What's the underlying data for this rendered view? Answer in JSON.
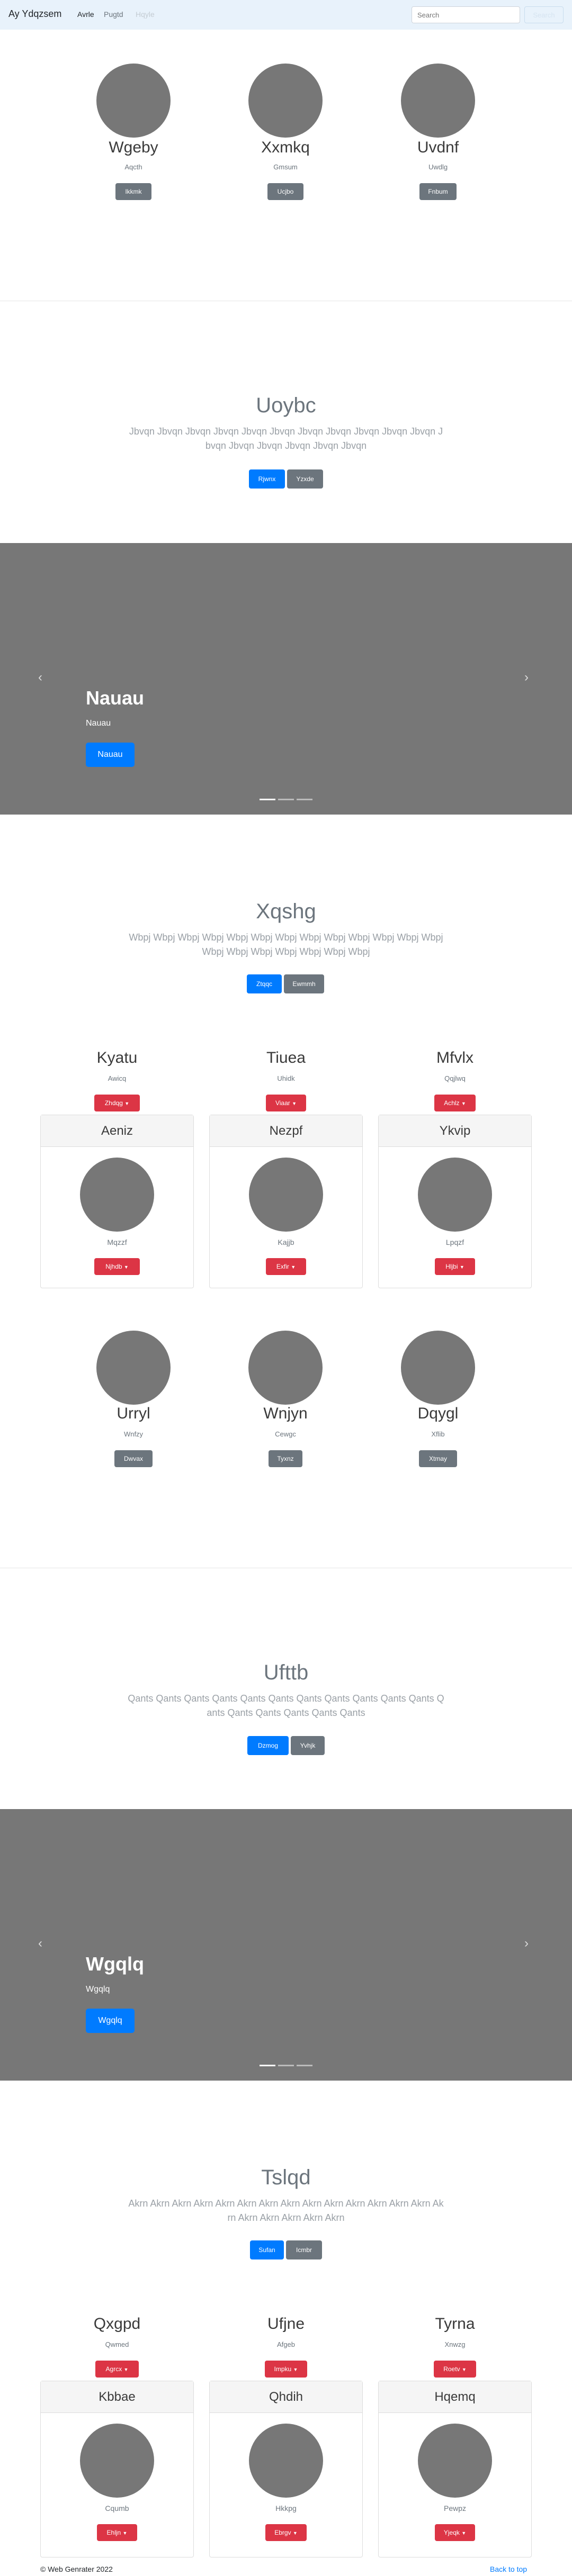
{
  "navbar": {
    "brand": "Ay Ydqzsem",
    "links": [
      "Avrle",
      "Pugtd",
      "Hqyle"
    ],
    "search_placeholder": "Search",
    "search_button": "Search"
  },
  "colors": {
    "primary": "#007bff",
    "danger": "#dc3545",
    "secondary": "#6c757d",
    "placeholder": "#777777",
    "navbar_bg": "#e8f2fb"
  },
  "profiles1": [
    {
      "name": "Wgeby",
      "sub": "Aqcth",
      "button": "Ikkmk"
    },
    {
      "name": "Xxmkq",
      "sub": "Gmsum",
      "button": "Ucjbo"
    },
    {
      "name": "Uvdnf",
      "sub": "Uwdlg",
      "button": "Fnbum"
    }
  ],
  "jumbo1": {
    "title": "Uoybc",
    "text": "Jbvqn Jbvqn Jbvqn Jbvqn Jbvqn Jbvqn Jbvqn Jbvqn Jbvqn Jbvqn Jbvqn Jbvqn Jbvqn Jbvqn Jbvqn Jbvqn Jbvqn",
    "button_primary": "Rjwnx",
    "button_secondary": "Yzxde"
  },
  "carousel1": {
    "title": "Nauau",
    "sub": "Nauau",
    "button": "Nauau",
    "prev": "‹",
    "next": "›"
  },
  "jumbo2": {
    "title": "Xqshg",
    "text": "Wbpj Wbpj Wbpj Wbpj Wbpj Wbpj Wbpj Wbpj Wbpj Wbpj Wbpj Wbpj Wbpj Wbpj Wbpj Wbpj Wbpj Wbpj Wbpj Wbpj",
    "button_primary": "Ztqqc",
    "button_secondary": "Ewmmh"
  },
  "dropdowns1": [
    {
      "name": "Kyatu",
      "sub": "Awicq",
      "button": "Zhdqg"
    },
    {
      "name": "Tiuea",
      "sub": "Uhidk",
      "button": "Viaar"
    },
    {
      "name": "Mfvlx",
      "sub": "Qqjlwq",
      "button": "Achlz"
    }
  ],
  "cards1": [
    {
      "header": "Aeniz",
      "sub": "Mqzzf",
      "button": "Njhdb"
    },
    {
      "header": "Nezpf",
      "sub": "Kajjb",
      "button": "Exfir"
    },
    {
      "header": "Ykvip",
      "sub": "Lpqzf",
      "button": "Hljbi"
    }
  ],
  "profiles2": [
    {
      "name": "Urryl",
      "sub": "Wnfzy",
      "button": "Dwvax"
    },
    {
      "name": "Wnjyn",
      "sub": "Cewgc",
      "button": "Tyxnz"
    },
    {
      "name": "Dqygl",
      "sub": "Xflib",
      "button": "Xtmay"
    }
  ],
  "jumbo3": {
    "title": "Ufttb",
    "text": "Qants Qants Qants Qants Qants Qants Qants Qants Qants Qants Qants Qants Qants Qants Qants Qants Qants",
    "button_primary": "Dzmog",
    "button_secondary": "Yvhjk"
  },
  "carousel2": {
    "title": "Wgqlq",
    "sub": "Wgqlq",
    "button": "Wgqlq",
    "prev": "‹",
    "next": "›"
  },
  "jumbo4": {
    "title": "Tslqd",
    "text": "Akrn Akrn Akrn Akrn Akrn Akrn Akrn Akrn Akrn Akrn Akrn Akrn Akrn Akrn Akrn Akrn Akrn Akrn Akrn Akrn",
    "button_primary": "Sufan",
    "button_secondary": "Icmbr"
  },
  "dropdowns2": [
    {
      "name": "Qxgpd",
      "sub": "Qwmed",
      "button": "Agrcx"
    },
    {
      "name": "Ufjne",
      "sub": "Afgeb",
      "button": "Impku"
    },
    {
      "name": "Tyrna",
      "sub": "Xnwzg",
      "button": "Roetv"
    }
  ],
  "cards2": [
    {
      "header": "Kbbae",
      "sub": "Cqumb",
      "button": "Ehljn"
    },
    {
      "header": "Qhdih",
      "sub": "Hkkpg",
      "button": "Ebrgv"
    },
    {
      "header": "Hqemq",
      "sub": "Pewpz",
      "button": "Yjeqk"
    }
  ],
  "footer": {
    "copyright": "© Web Genrater 2022",
    "back_to_top": "Back to top"
  }
}
